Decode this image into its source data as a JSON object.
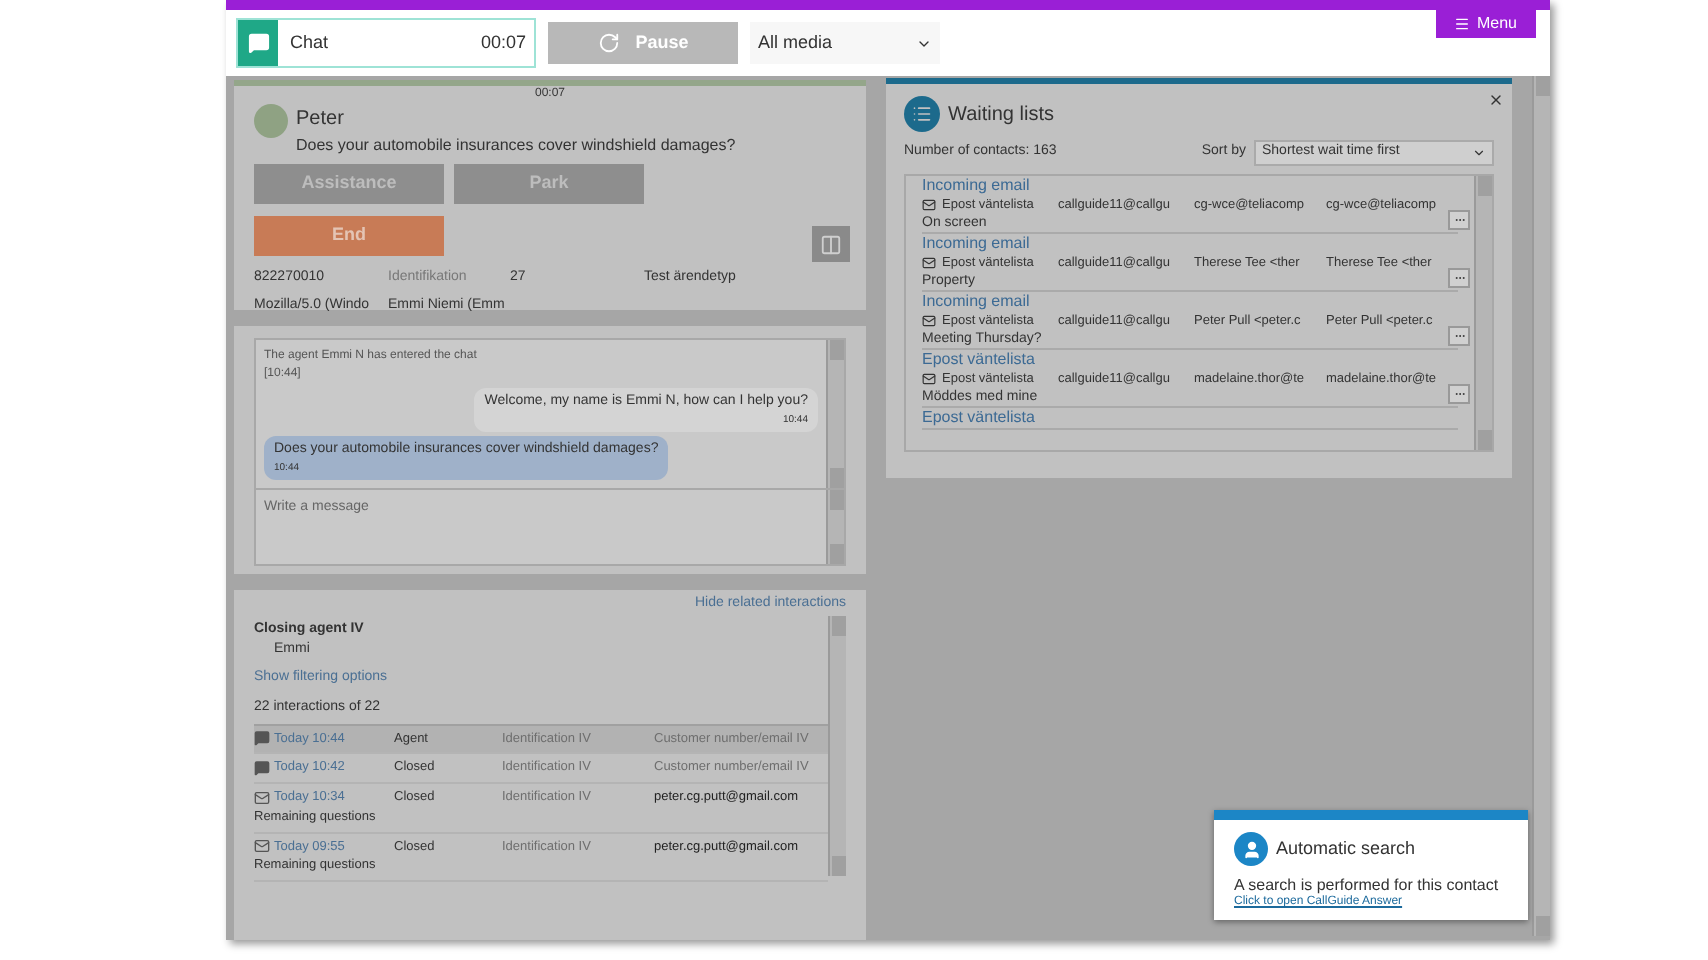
{
  "toolbar": {
    "chat_tab": {
      "label": "Chat",
      "timer": "00:07"
    },
    "pause_button": "Pause",
    "media_filter": "All media",
    "menu_button": "Menu"
  },
  "conversation": {
    "timer": "00:07",
    "contact_name": "Peter",
    "subject": "Does your automobile insurances cover windshield damages?",
    "buttons": [
      {
        "label": "Assistance",
        "kind": "secondary"
      },
      {
        "label": "Park",
        "kind": "secondary"
      },
      {
        "label": "End",
        "kind": "danger"
      }
    ],
    "details": [
      [
        {
          "text": "822270010",
          "muted": false
        },
        {
          "text": "Identifikation",
          "muted": true
        },
        {
          "text": "27",
          "muted": false
        },
        {
          "text": "Test ärendetyp",
          "muted": false
        }
      ],
      [
        {
          "text": "Mozilla/5.0 (Windo",
          "muted": false
        },
        {
          "text": "Emmi Niemi (Emm",
          "muted": false
        }
      ]
    ]
  },
  "chat": {
    "messages": [
      {
        "kind": "system",
        "text": "The agent Emmi N has entered the chat",
        "time": "[10:44]"
      },
      {
        "kind": "agent",
        "text": "Welcome, my name is Emmi N, how can I help you?",
        "time": "10:44"
      },
      {
        "kind": "customer",
        "text": "Does your automobile insurances cover windshield damages?",
        "time": "10:44"
      }
    ],
    "input_placeholder": "Write a message"
  },
  "related": {
    "toggle_link": "Hide related interactions",
    "closing_agent_label": "Closing agent IV",
    "closing_agent_value": "Emmi",
    "filter_link": "Show filtering options",
    "count": "22 interactions of 22",
    "rows": [
      {
        "kind": "chat",
        "time": "Today 10:44",
        "status": "Agent",
        "identification": "Identification IV",
        "customer": "Customer number/email IV",
        "customer_muted": true,
        "selected": true
      },
      {
        "kind": "chat",
        "time": "Today 10:42",
        "status": "Closed",
        "identification": "Identification IV",
        "customer": "Customer number/email IV",
        "customer_muted": true,
        "selected": false
      },
      {
        "kind": "email",
        "time": "Today 10:34",
        "status": "Closed",
        "identification": "Identification IV",
        "customer": "peter.cg.putt@gmail.com",
        "customer_muted": false,
        "subject": "Remaining questions",
        "selected": false
      },
      {
        "kind": "email",
        "time": "Today 09:55",
        "status": "Closed",
        "identification": "Identification IV",
        "customer": "peter.cg.putt@gmail.com",
        "customer_muted": false,
        "subject": "Remaining questions",
        "selected": false
      }
    ]
  },
  "waiting_lists": {
    "title": "Waiting lists",
    "count_label": "Number of contacts: 163",
    "sort_label": "Sort by",
    "sort_value": "Shortest wait time first",
    "items": [
      {
        "heading": "Incoming email",
        "queue": "Epost väntelista",
        "column_1": "callguide11@callgu",
        "column_2": "cg-wce@teliacomp",
        "column_3": "cg-wce@teliacomp",
        "subject": "On screen"
      },
      {
        "heading": "Incoming email",
        "queue": "Epost väntelista",
        "column_1": "callguide11@callgu",
        "column_2": "Therese Tee <ther",
        "column_3": "Therese Tee <ther",
        "subject": "Property"
      },
      {
        "heading": "Incoming email",
        "queue": "Epost väntelista",
        "column_1": "callguide11@callgu",
        "column_2": "Peter Pull <peter.c",
        "column_3": "Peter Pull <peter.c",
        "subject": "Meeting Thursday?"
      },
      {
        "heading": "Epost väntelista",
        "queue": "Epost väntelista",
        "column_1": "callguide11@callgu",
        "column_2": "madelaine.thor@te",
        "column_3": "madelaine.thor@te",
        "subject": "Möddes med mine"
      },
      {
        "heading": "Epost väntelista"
      }
    ]
  },
  "popup": {
    "title": "Automatic search",
    "text": "A search is performed for this contact",
    "link": "Click to open CallGuide Answer"
  }
}
